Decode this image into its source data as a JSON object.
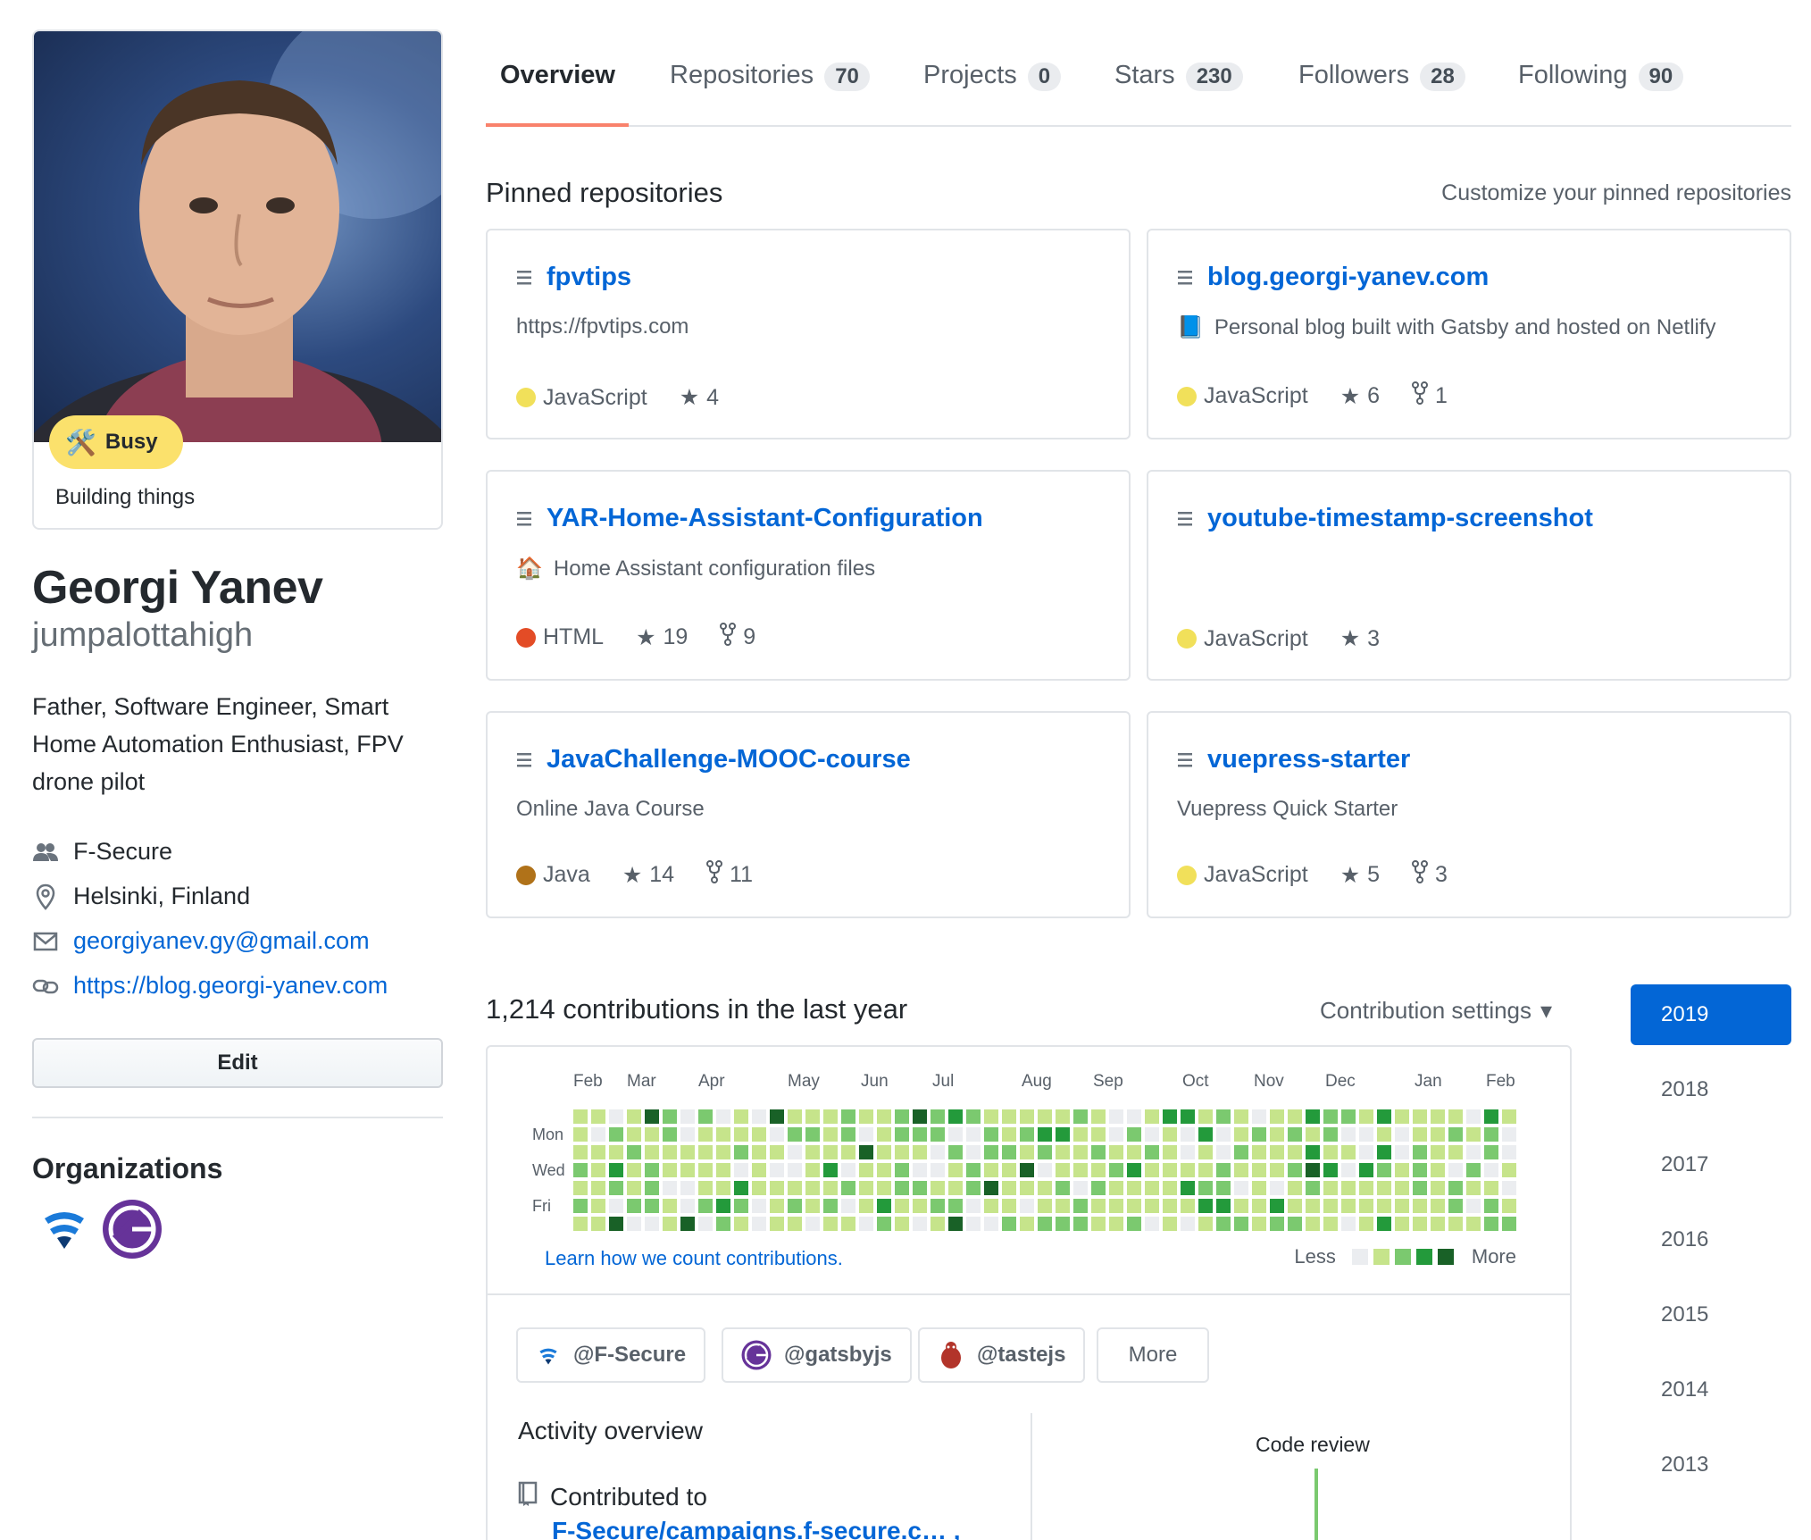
{
  "profile": {
    "status_emoji": "🛠️",
    "status_label": "Busy",
    "status_message": "Building things",
    "name": "Georgi Yanev",
    "login": "jumpalottahigh",
    "bio": "Father, Software Engineer, Smart Home Automation Enthusiast, FPV drone pilot",
    "company": "F-Secure",
    "location": "Helsinki, Finland",
    "email": "georgiyanev.gy@gmail.com",
    "website": "https://blog.georgi-yanev.com",
    "edit_label": "Edit",
    "organizations_heading": "Organizations"
  },
  "tabs": [
    {
      "label": "Overview",
      "count": null,
      "selected": true
    },
    {
      "label": "Repositories",
      "count": "70"
    },
    {
      "label": "Projects",
      "count": "0"
    },
    {
      "label": "Stars",
      "count": "230"
    },
    {
      "label": "Followers",
      "count": "28"
    },
    {
      "label": "Following",
      "count": "90"
    }
  ],
  "pinned": {
    "heading": "Pinned repositories",
    "customize": "Customize your pinned repositories",
    "repos": [
      {
        "name": "fpvtips",
        "description": "https://fpvtips.com",
        "desc_emoji": "",
        "language": "JavaScript",
        "lang_color": "#f1e05a",
        "stars": "4",
        "forks": ""
      },
      {
        "name": "blog.georgi-yanev.com",
        "description": "Personal blog built with Gatsby and hosted on Netlify",
        "desc_emoji": "📘",
        "language": "JavaScript",
        "lang_color": "#f1e05a",
        "stars": "6",
        "forks": "1"
      },
      {
        "name": "YAR-Home-Assistant-Configuration",
        "description": "Home Assistant configuration files",
        "desc_emoji": "🏠",
        "language": "HTML",
        "lang_color": "#e34c26",
        "stars": "19",
        "forks": "9"
      },
      {
        "name": "youtube-timestamp-screenshot",
        "description": "",
        "desc_emoji": "",
        "language": "JavaScript",
        "lang_color": "#f1e05a",
        "stars": "3",
        "forks": ""
      },
      {
        "name": "JavaChallenge-MOOC-course",
        "description": "Online Java Course",
        "desc_emoji": "",
        "language": "Java",
        "lang_color": "#b07219",
        "stars": "14",
        "forks": "11"
      },
      {
        "name": "vuepress-starter",
        "description": "Vuepress Quick Starter",
        "desc_emoji": "",
        "language": "JavaScript",
        "lang_color": "#f1e05a",
        "stars": "5",
        "forks": "3"
      }
    ]
  },
  "contributions": {
    "heading": "1,214 contributions in the last year",
    "settings_label": "Contribution settings",
    "months": [
      "Feb",
      "Mar",
      "Apr",
      "May",
      "Jun",
      "Jul",
      "Aug",
      "Sep",
      "Oct",
      "Nov",
      "Dec",
      "Jan",
      "Feb"
    ],
    "days": [
      "Mon",
      "Wed",
      "Fri"
    ],
    "learn_link": "Learn how we count contributions.",
    "legend_less": "Less",
    "legend_more": "More",
    "level_colors": [
      "#ebedf0",
      "#c6e48b",
      "#7bc96f",
      "#239a3b",
      "#196127"
    ],
    "org_filters": [
      {
        "label": "@F-Secure",
        "icon": "fsecure-logo-icon"
      },
      {
        "label": "@gatsbyjs",
        "icon": "gatsby-logo-icon"
      },
      {
        "label": "@tastejs",
        "icon": "tastejs-logo-icon"
      }
    ],
    "filter_more": "More",
    "activity_heading": "Activity overview",
    "contributed_label": "Contributed to",
    "contributed_repo": "F-Secure/campaigns.f-secure.c… ,",
    "code_review_label": "Code review"
  },
  "years": [
    {
      "label": "2019",
      "selected": true
    },
    {
      "label": "2018"
    },
    {
      "label": "2017"
    },
    {
      "label": "2016"
    },
    {
      "label": "2015"
    },
    {
      "label": "2014"
    },
    {
      "label": "2013"
    }
  ]
}
